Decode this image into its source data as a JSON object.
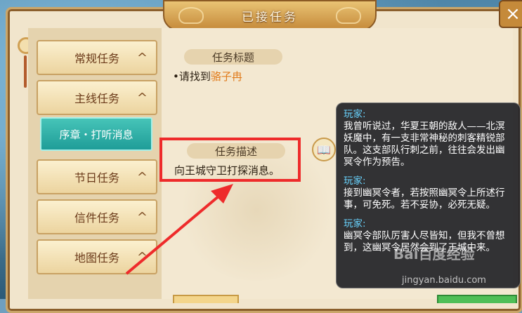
{
  "window": {
    "title": "已接任务",
    "close_symbol": "×"
  },
  "categories": [
    {
      "label": "常规任务",
      "arrow": "^"
    },
    {
      "label": "主线任务",
      "arrow": "^"
    },
    {
      "label": "节日任务",
      "arrow": "^"
    },
    {
      "label": "信件任务",
      "arrow": "^"
    },
    {
      "label": "地图任务",
      "arrow": "^"
    }
  ],
  "selected_subtask": {
    "label": "序章・打听消息"
  },
  "task": {
    "title_header": "任务标题",
    "bullet": "•",
    "line_prefix": "请找到",
    "target_name": "骆子冉",
    "description_header": "任务描述",
    "description": "向王城守卫打探消息。"
  },
  "book_icon": "📖",
  "dialog": [
    {
      "speaker": "玩家:",
      "text": "我曾听说过，华夏王朝的敌人——北溟妖魔中，有一支非常神秘的刺客精锐部队。这支部队行刺之前，往往会发出幽冥令作为预告。"
    },
    {
      "speaker": "玩家:",
      "text": "接到幽冥令者，若按照幽冥令上所述行事，可免死。若不妥协，必死无疑。"
    },
    {
      "speaker": "玩家:",
      "text": "幽冥令部队厉害人尽皆知，但我不曾想到，这幽冥令居然会到了王城中来。"
    }
  ],
  "watermark": {
    "text": "Bai百度经验",
    "url": "jingyan.baidu.com"
  },
  "colors": {
    "accent_teal": "#1f9d98",
    "target_orange": "#e07a1a",
    "highlight_red": "#ee2b2b",
    "speaker_blue": "#69d4ff"
  }
}
